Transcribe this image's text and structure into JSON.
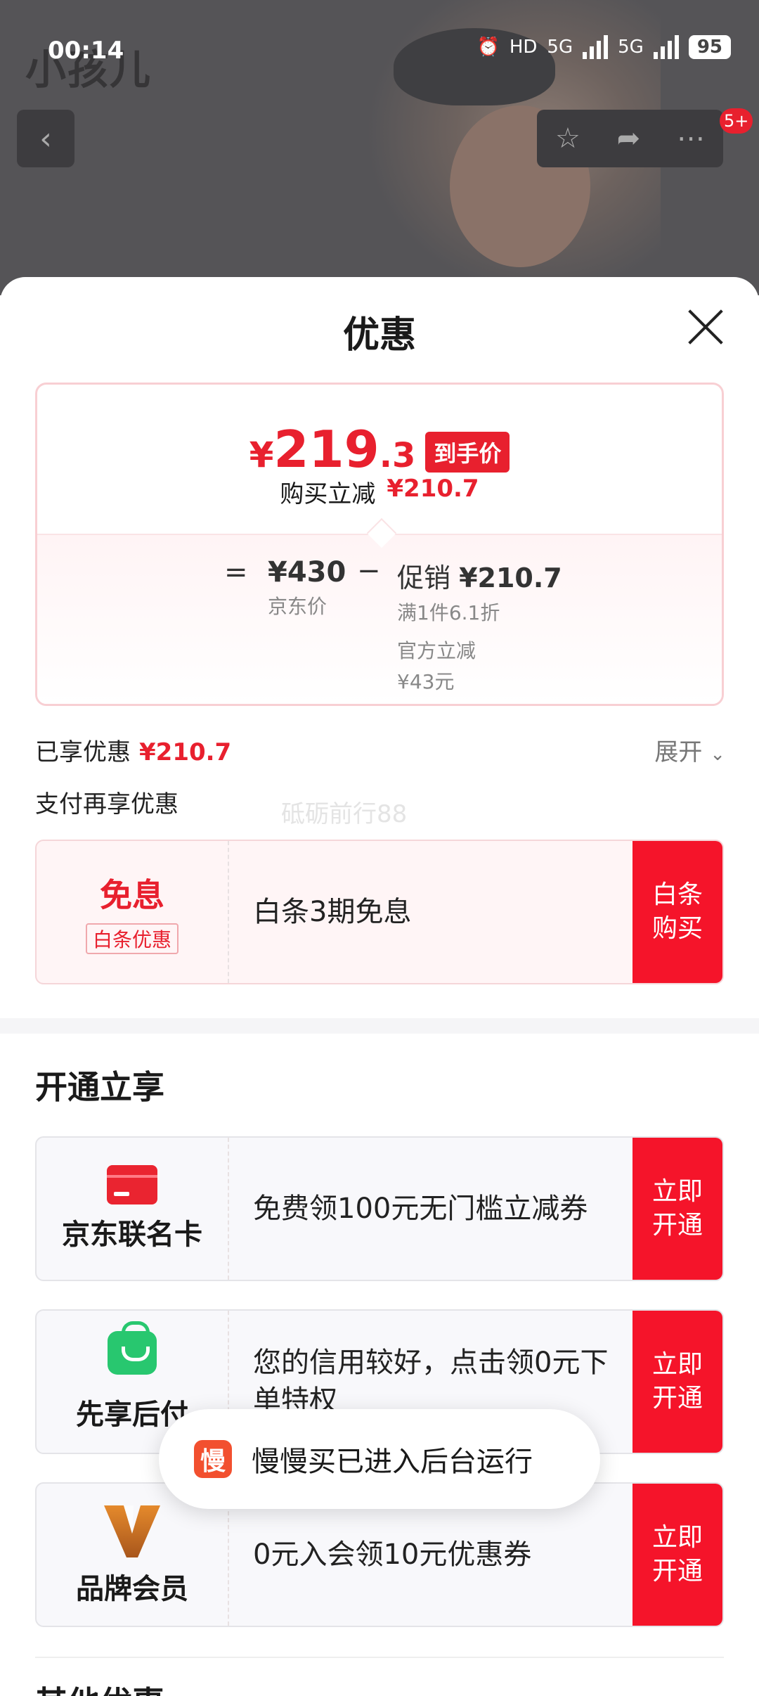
{
  "status_bar": {
    "time": "00:14",
    "hd": "HD",
    "net1": "5G",
    "net2": "5G",
    "battery": "95"
  },
  "background": {
    "brand_logo": "小孩儿",
    "cart_badge": "5+"
  },
  "sheet": {
    "title": "优惠",
    "price": {
      "yen": "¥",
      "int": "219",
      "dec": ".3",
      "tag": "到手价",
      "sub_label": "购买立减",
      "sub_value": "¥210.7"
    },
    "breakdown": {
      "eq": "=",
      "jd_price": "¥430",
      "jd_label": "京东价",
      "minus": "−",
      "promo_label": "促销",
      "promo_value": "¥210.7",
      "promo_rule": "满1件6.1折",
      "official_label": "官方立减",
      "official_value": "¥43元"
    },
    "enjoyed_label": "已享优惠",
    "enjoyed_value": "¥210.7",
    "expand_label": "展开",
    "pay_title": "支付再享优惠",
    "watermark": "砥砺前行88",
    "interest_offer": {
      "title": "免息",
      "tag": "白条优惠",
      "desc": "白条3期免息",
      "button": "白条\n购买"
    },
    "open_title": "开通立享",
    "open_offers": [
      {
        "name": "京东联名卡",
        "desc": "免费领100元无门槛立减券",
        "button": "立即\n开通",
        "icon": "credit-card-icon"
      },
      {
        "name": "先享后付",
        "desc": "您的信用较好，点击领0元下单特权",
        "button": "立即\n开通",
        "icon": "shopping-bag-icon"
      },
      {
        "name": "品牌会员",
        "desc": "0元入会领10元优惠券",
        "button": "立即\n开通",
        "icon": "brand-v-icon"
      }
    ],
    "more_title": "其他优惠"
  },
  "toast": {
    "icon_char": "慢",
    "text": "慢慢买已进入后台运行"
  },
  "colors": {
    "accent_red": "#e8202e",
    "button_red": "#f5142a",
    "green": "#28c76f"
  }
}
